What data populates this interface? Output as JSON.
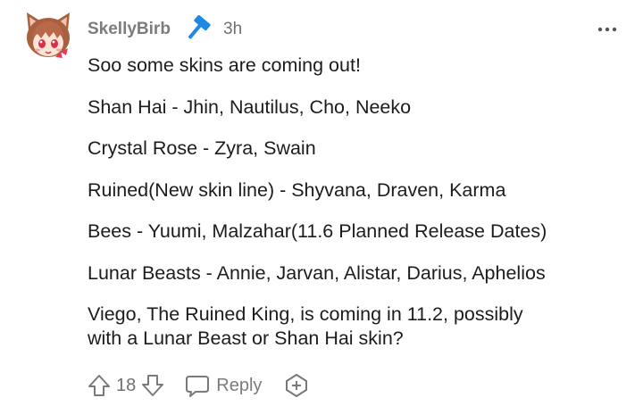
{
  "comment": {
    "author": "SkellyBirb",
    "time": "3h",
    "lines": [
      "Soo some skins are coming out!",
      "Shan Hai - Jhin, Nautilus, Cho, Neeko",
      "Crystal Rose - Zyra, Swain",
      "Ruined(New skin line) - Shyvana, Draven, Karma",
      "Bees - Yuumi, Malzahar(11.6 Planned Release Dates)",
      "Lunar Beasts - Annie, Jarvan, Alistar, Darius, Aphelios",
      "Viego, The Ruined King, is coming in 11.2, possibly\nwith a Lunar Beast or Shan Hai skin?"
    ]
  },
  "actions": {
    "vote_count": "18",
    "reply_label": "Reply"
  },
  "icons": {
    "avatar": "avatar-fox-girl",
    "flair": "hammer-icon",
    "more": "more-options-icon",
    "upvote": "upvote-arrow-icon",
    "downvote": "downvote-arrow-icon",
    "reply": "speech-bubble-icon",
    "award": "award-plus-icon"
  },
  "colors": {
    "text": "#1c1c1c",
    "meta": "#7c7c7c",
    "flair_blue": "#1e88e5"
  }
}
